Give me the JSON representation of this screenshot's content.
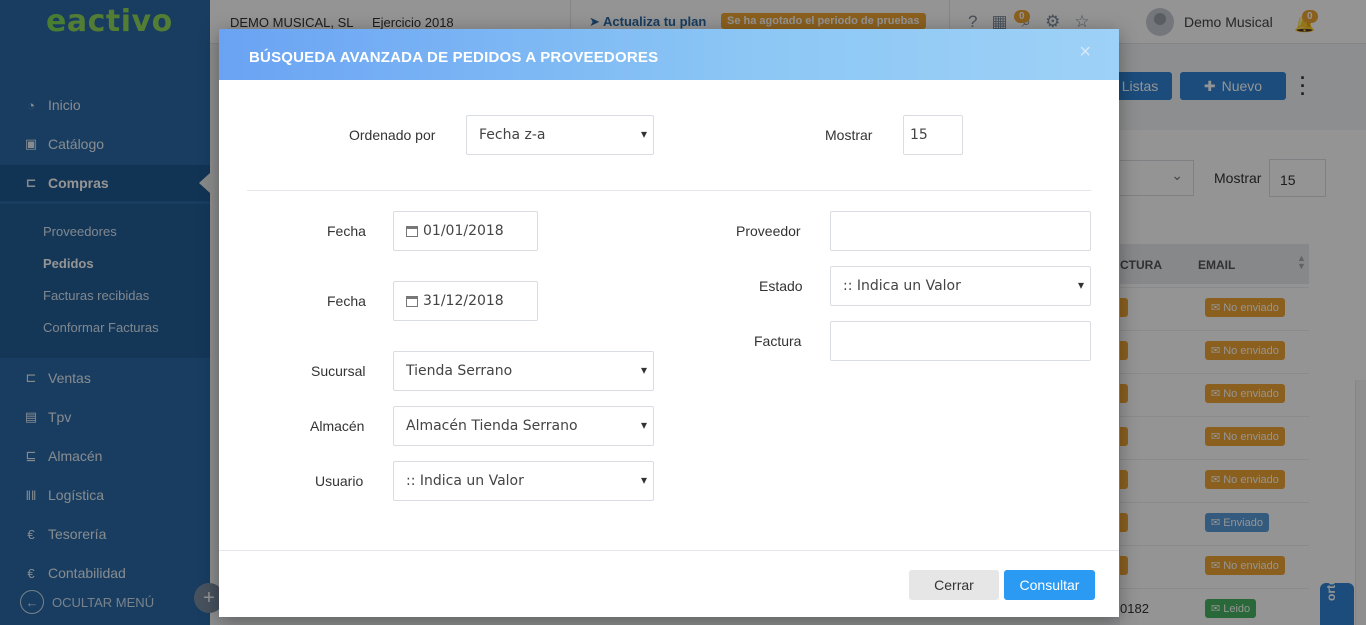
{
  "sidebar": {
    "logo_a": "e",
    "logo_b": "activo",
    "items": [
      {
        "label": "Inicio",
        "icon": "dashboard-icon"
      },
      {
        "label": "Catálogo",
        "icon": "catalog-icon"
      },
      {
        "label": "Compras",
        "icon": "cart-icon"
      },
      {
        "label": "Ventas",
        "icon": "sales-icon"
      },
      {
        "label": "Tpv",
        "icon": "pos-icon"
      },
      {
        "label": "Almacén",
        "icon": "warehouse-icon"
      },
      {
        "label": "Logística",
        "icon": "barcode-icon"
      },
      {
        "label": "Tesorería",
        "icon": "euro-icon"
      },
      {
        "label": "Contabilidad",
        "icon": "euro-icon"
      }
    ],
    "subitems": [
      "Proveedores",
      "Pedidos",
      "Facturas recibidas",
      "Conformar Facturas"
    ],
    "hide_menu": "OCULTAR MENÚ"
  },
  "topbar": {
    "company": "DEMO MUSICAL, SL",
    "ejercicio": "Ejercicio 2018",
    "plan_link": "Actualiza tu plan",
    "plan_badge": "Se ha agotado el periodo de pruebas",
    "calendar_count": "0",
    "notif_count": "0",
    "user_name": "Demo Musical"
  },
  "background": {
    "listas": "Listas",
    "nuevo": "Nuevo",
    "mostrar_label": "Mostrar",
    "mostrar_value": "15",
    "col_factura": "CTURA",
    "col_email": "EMAIL",
    "rows": [
      {
        "status": "No enviado",
        "color": "orange"
      },
      {
        "status": "No enviado",
        "color": "orange"
      },
      {
        "status": "No enviado",
        "color": "orange"
      },
      {
        "status": "No enviado",
        "color": "orange"
      },
      {
        "status": "No enviado",
        "color": "orange"
      },
      {
        "status": "Enviado",
        "color": "blue"
      },
      {
        "status": "No enviado",
        "color": "orange"
      },
      {
        "status": "Leido",
        "color": "green"
      }
    ],
    "last_number": "0182",
    "soporte": "orte"
  },
  "modal": {
    "title": "BÚSQUEDA AVANZADA DE PEDIDOS A PROVEEDORES",
    "close": "×",
    "ordenado_label": "Ordenado por",
    "ordenado_value": "Fecha z-a",
    "mostrar_label": "Mostrar",
    "mostrar_value": "15",
    "fecha1_label": "Fecha",
    "fecha1_value": "01/01/2018",
    "fecha2_label": "Fecha",
    "fecha2_value": "31/12/2018",
    "sucursal_label": "Sucursal",
    "sucursal_value": "Tienda Serrano",
    "almacen_label": "Almacén",
    "almacen_value": "Almacén Tienda Serrano",
    "usuario_label": "Usuario",
    "usuario_value": ":: Indica un Valor",
    "proveedor_label": "Proveedor",
    "proveedor_value": "",
    "estado_label": "Estado",
    "estado_value": ":: Indica un Valor",
    "factura_label": "Factura",
    "factura_value": "",
    "cerrar": "Cerrar",
    "consultar": "Consultar"
  },
  "colors": {
    "sidebar": "#2a6aa6",
    "accent": "#2b9af3",
    "badge": "#f0a534"
  }
}
